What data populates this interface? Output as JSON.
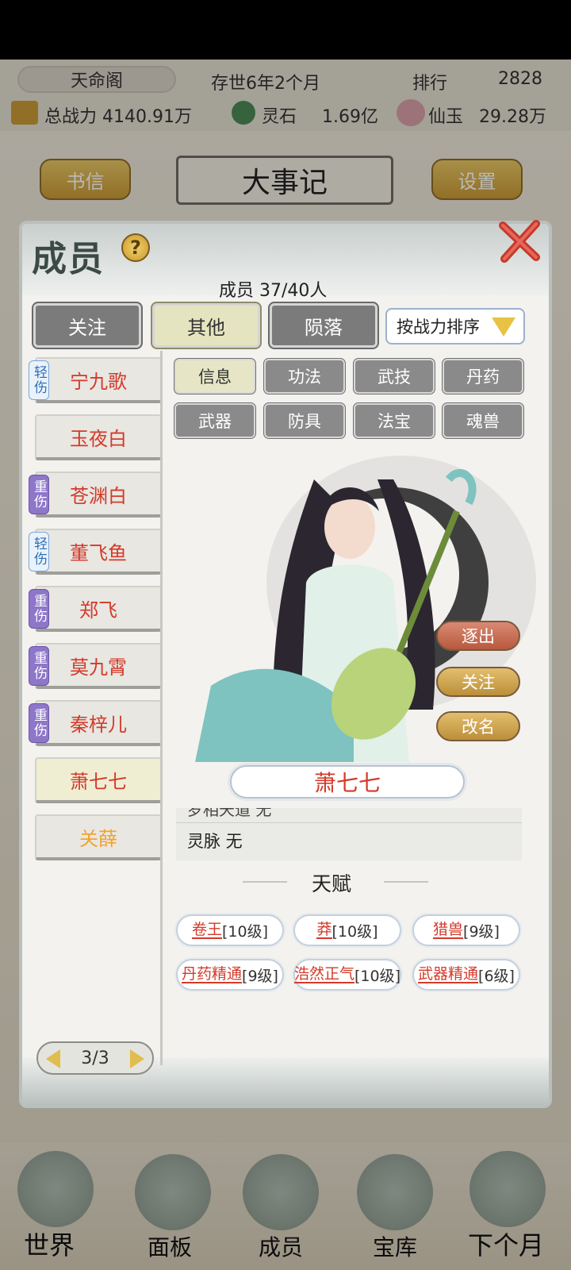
{
  "header": {
    "sect_name": "天命阁",
    "age": "存世6年2个月",
    "ranking_label": "排行",
    "ranking_value": "2828",
    "total_power": "总战力 4140.91万",
    "spirit_stone_label": "灵石",
    "spirit_stone_value": "1.69亿",
    "immortal_jade_label": "仙玉",
    "immortal_jade_value": "29.28万",
    "letters_button": "书信",
    "page_title": "大事记",
    "settings_button": "设置"
  },
  "modal": {
    "title": "成员",
    "member_count": "成员  37/40人",
    "tabs": [
      "关注",
      "其他",
      "陨落"
    ],
    "active_tab": "其他",
    "sort_label": "按战力排序",
    "members": [
      {
        "name": "宁九歌",
        "badge": "轻伤",
        "badge_type": "light"
      },
      {
        "name": "玉夜白",
        "badge": "",
        "badge_type": ""
      },
      {
        "name": "苍渊白",
        "badge": "重伤",
        "badge_type": "heavy"
      },
      {
        "name": "董飞鱼",
        "badge": "轻伤",
        "badge_type": "light"
      },
      {
        "name": "郑飞",
        "badge": "重伤",
        "badge_type": "heavy"
      },
      {
        "name": "莫九霄",
        "badge": "重伤",
        "badge_type": "heavy"
      },
      {
        "name": "秦梓儿",
        "badge": "重伤",
        "badge_type": "heavy"
      },
      {
        "name": "萧七七",
        "badge": "",
        "badge_type": ""
      },
      {
        "name": "关薛",
        "badge": "",
        "badge_type": ""
      }
    ],
    "sub_tabs": [
      "信息",
      "功法",
      "武技",
      "丹药",
      "武器",
      "防具",
      "法宝",
      "魂兽"
    ],
    "active_sub_tab": "信息",
    "actions": {
      "expel": "逐出",
      "follow": "关注",
      "rename": "改名"
    },
    "selected_name": "萧七七",
    "info_cut_text": "罗相天道 无",
    "spirit_vein": "灵脉 无",
    "talent_title": "天赋",
    "talents": [
      {
        "name": "卷王",
        "level": "[10级]"
      },
      {
        "name": "莽",
        "level": "[10级]"
      },
      {
        "name": "猎兽",
        "level": "[9级]"
      },
      {
        "name": "丹药精通",
        "level": "[9级]"
      },
      {
        "name": "浩然正气",
        "level": "[10级]"
      },
      {
        "name": "武器精通",
        "level": "[6级]"
      }
    ],
    "pager": "3/3"
  },
  "bottom_nav": [
    "世界",
    "面板",
    "成员",
    "宝库",
    "下个月"
  ],
  "colors": {
    "accent_red": "#d33a2a",
    "gold": "#e0bd4d",
    "heavy_badge": "#8e76c9"
  }
}
